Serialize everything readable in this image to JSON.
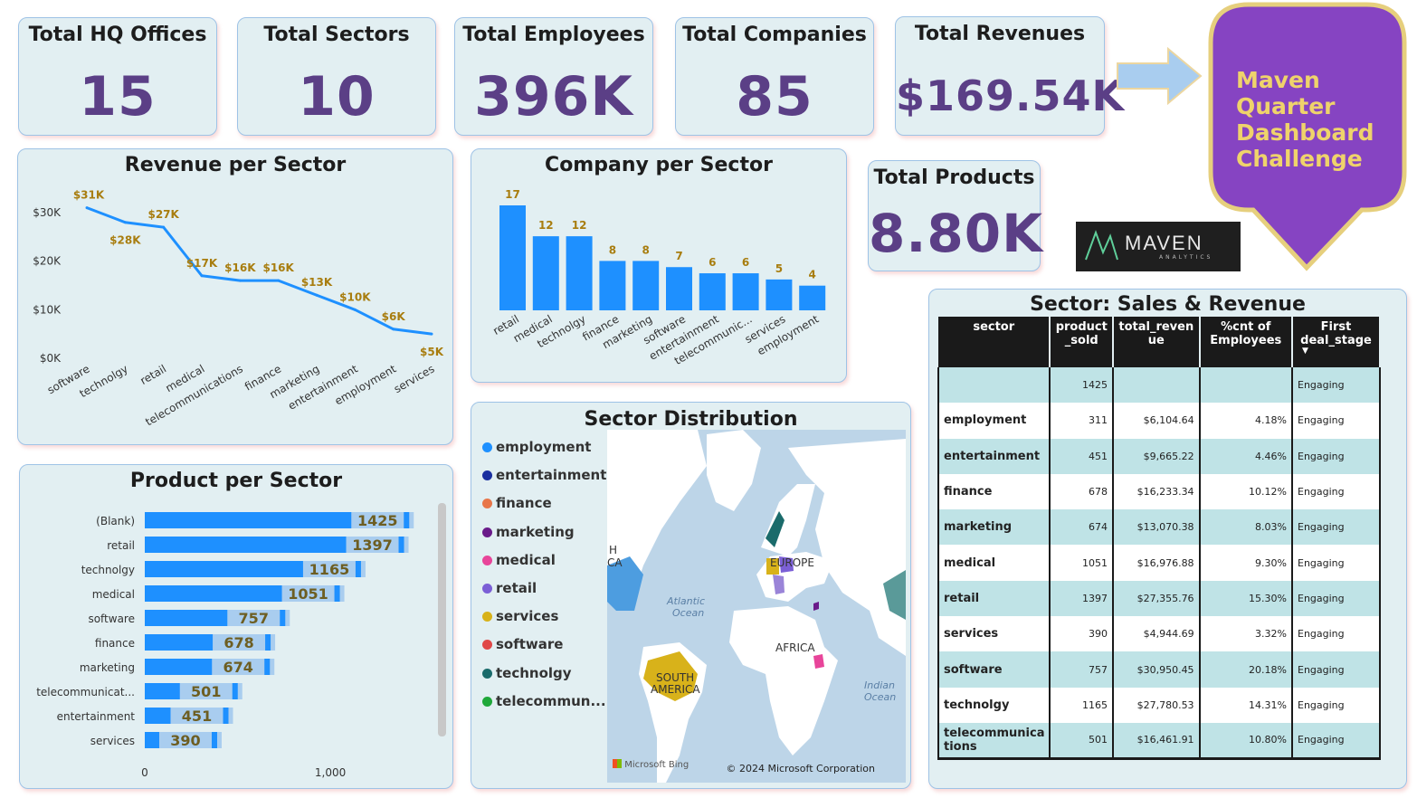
{
  "kpis": {
    "hq_offices": {
      "title": "Total HQ Offices",
      "value": "15"
    },
    "sectors": {
      "title": "Total Sectors",
      "value": "10"
    },
    "employees": {
      "title": "Total Employees",
      "value": "396K"
    },
    "companies": {
      "title": "Total Companies",
      "value": "85"
    },
    "revenues": {
      "title": "Total Revenues",
      "value": "$169.54K"
    },
    "products": {
      "title": "Total Products",
      "value": "8.80K"
    }
  },
  "banner": {
    "line1": "Maven Quarter",
    "line2": "Dashboard",
    "line3": "Challenge"
  },
  "logo": {
    "name": "MAVEN",
    "sub": "ANALYTICS"
  },
  "revenue_chart": {
    "title": "Revenue per Sector"
  },
  "company_chart": {
    "title": "Company per Sector"
  },
  "product_chart": {
    "title": "Product per Sector"
  },
  "map": {
    "title": "Sector Distribution",
    "legend": [
      {
        "label": "employment",
        "color": "#1e90ff"
      },
      {
        "label": "entertainment",
        "color": "#1a2fa0"
      },
      {
        "label": "finance",
        "color": "#e8764a"
      },
      {
        "label": "marketing",
        "color": "#6a1b8a"
      },
      {
        "label": "medical",
        "color": "#e8459a"
      },
      {
        "label": "retail",
        "color": "#7b5fd6"
      },
      {
        "label": "services",
        "color": "#d8b21a"
      },
      {
        "label": "software",
        "color": "#e04848"
      },
      {
        "label": "technolgy",
        "color": "#1a6b6b"
      },
      {
        "label": "telecommun...",
        "color": "#1fa83a"
      }
    ],
    "labels": {
      "europe": "EUROPE",
      "africa": "AFRICA",
      "south_america_1": "SOUTH",
      "south_america_2": "AMERICA",
      "atlantic_1": "Atlantic",
      "atlantic_2": "Ocean",
      "indian_1": "Indian",
      "indian_2": "Ocean",
      "na_1": "H",
      "na_2": "CA"
    },
    "bing": "Microsoft Bing",
    "copyright": "© 2024 Microsoft Corporation"
  },
  "table": {
    "title": "Sector: Sales & Revenue",
    "headers": [
      "sector",
      "product\n_sold",
      "total_reven\nue",
      "%cnt of\nEmployees",
      "First\ndeal_stage"
    ],
    "rows": [
      {
        "sector": "",
        "sold": "1425",
        "revenue": "",
        "pct": "",
        "stage": "Engaging"
      },
      {
        "sector": "employment",
        "sold": "311",
        "revenue": "$6,104.64",
        "pct": "4.18%",
        "stage": "Engaging"
      },
      {
        "sector": "entertainment",
        "sold": "451",
        "revenue": "$9,665.22",
        "pct": "4.46%",
        "stage": "Engaging"
      },
      {
        "sector": "finance",
        "sold": "678",
        "revenue": "$16,233.34",
        "pct": "10.12%",
        "stage": "Engaging"
      },
      {
        "sector": "marketing",
        "sold": "674",
        "revenue": "$13,070.38",
        "pct": "8.03%",
        "stage": "Engaging"
      },
      {
        "sector": "medical",
        "sold": "1051",
        "revenue": "$16,976.88",
        "pct": "9.30%",
        "stage": "Engaging"
      },
      {
        "sector": "retail",
        "sold": "1397",
        "revenue": "$27,355.76",
        "pct": "15.30%",
        "stage": "Engaging"
      },
      {
        "sector": "services",
        "sold": "390",
        "revenue": "$4,944.69",
        "pct": "3.32%",
        "stage": "Engaging"
      },
      {
        "sector": "software",
        "sold": "757",
        "revenue": "$30,950.45",
        "pct": "20.18%",
        "stage": "Engaging"
      },
      {
        "sector": "technolgy",
        "sold": "1165",
        "revenue": "$27,780.53",
        "pct": "14.31%",
        "stage": "Engaging"
      },
      {
        "sector": "telecommunica\ntions",
        "sold": "501",
        "revenue": "$16,461.91",
        "pct": "10.80%",
        "stage": "Engaging"
      }
    ]
  },
  "chart_data": [
    {
      "type": "line",
      "title": "Revenue per Sector",
      "categories": [
        "software",
        "technolgy",
        "retail",
        "medical",
        "telecommunications",
        "finance",
        "marketing",
        "entertainment",
        "employment",
        "services"
      ],
      "values": [
        31,
        28,
        27,
        17,
        16,
        16,
        13,
        10,
        6,
        5
      ],
      "data_labels": [
        "$31K",
        "$28K",
        "$27K",
        "$17K",
        "$16K",
        "$16K",
        "$13K",
        "$10K",
        "$6K",
        "$5K"
      ],
      "yticks": [
        "$0K",
        "$10K",
        "$20K",
        "$30K"
      ],
      "ylim": [
        0,
        30
      ],
      "color": "#1e90ff"
    },
    {
      "type": "bar",
      "title": "Company per Sector",
      "categories": [
        "retail",
        "medical",
        "technolgy",
        "finance",
        "marketing",
        "software",
        "entertainment",
        "telecommunic...",
        "services",
        "employment"
      ],
      "values": [
        17,
        12,
        12,
        8,
        8,
        7,
        6,
        6,
        5,
        4
      ],
      "color": "#1e90ff"
    },
    {
      "type": "bar",
      "orientation": "horizontal",
      "title": "Product per Sector",
      "categories": [
        "(Blank)",
        "retail",
        "technolgy",
        "medical",
        "software",
        "finance",
        "marketing",
        "telecommunicat...",
        "entertainment",
        "services"
      ],
      "values": [
        1425,
        1397,
        1165,
        1051,
        757,
        678,
        674,
        501,
        451,
        390
      ],
      "xticks": [
        "0",
        "1,000"
      ],
      "color": "#1e90ff"
    }
  ]
}
